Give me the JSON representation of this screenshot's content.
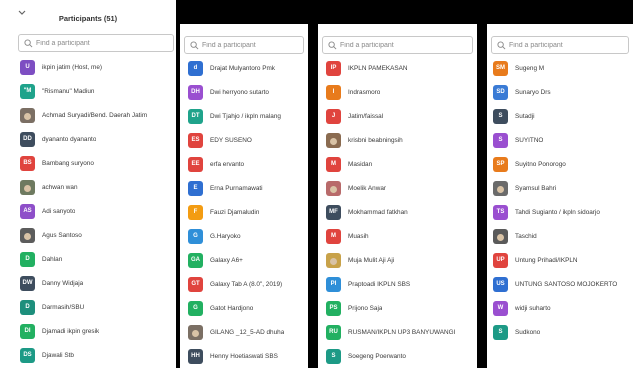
{
  "header": {
    "title": "Participants (51)"
  },
  "search": {
    "placeholder": "Find a participant"
  },
  "colors": {
    "purple": "#8e44ad",
    "teal": "#1e9c8a",
    "slate": "#4a5a6a",
    "red": "#e04040",
    "green": "#27ae60",
    "navy": "#2c3e50",
    "blue": "#2f6fd1",
    "orange": "#f39c12",
    "darkred": "#c0392b",
    "gray": "#4a4a4a",
    "crimson": "#d35400",
    "lightblue": "#3498db"
  },
  "panels": [
    {
      "participants": [
        {
          "initials": "U",
          "color": "#7d4ec2",
          "name": "ikpin jatim (Host, me)"
        },
        {
          "initials": "\"M",
          "color": "#1fa38b",
          "name": "\"Rismanu\" Madiun"
        },
        {
          "initials": "",
          "color": "#7b6f64",
          "photo": true,
          "name": "Achmad Suryadi/Bend. Daerah Jatim"
        },
        {
          "initials": "DD",
          "color": "#3e4d5e",
          "name": "dyananto dyananto"
        },
        {
          "initials": "BS",
          "color": "#e0443e",
          "name": "Bambang suryono"
        },
        {
          "initials": "",
          "color": "#6e7a60",
          "photo": true,
          "name": "achwan wan"
        },
        {
          "initials": "AS",
          "color": "#8e4fc9",
          "name": "Adi sanyoto"
        },
        {
          "initials": "",
          "color": "#5c5c5c",
          "photo": true,
          "name": "Agus Santoso"
        },
        {
          "initials": "D",
          "color": "#22b061",
          "name": "Dahlan"
        },
        {
          "initials": "DW",
          "color": "#3e4d5e",
          "name": "Danny Widjaja"
        },
        {
          "initials": "D",
          "color": "#1d8f7c",
          "name": "Darmasih/SBU"
        },
        {
          "initials": "DI",
          "color": "#22b061",
          "name": "Djamadi ikpin gresik"
        },
        {
          "initials": "DS",
          "color": "#1d9a86",
          "name": "Djawali Stb"
        }
      ]
    },
    {
      "participants": [
        {
          "initials": "d",
          "color": "#2f6fd1",
          "name": "Drajat Mulyantoro Pmk"
        },
        {
          "initials": "DH",
          "color": "#9a4fd0",
          "name": "Dwi herryono sutarto"
        },
        {
          "initials": "DT",
          "color": "#1fa38b",
          "name": "Dwi Tjahjo / ikpln malang"
        },
        {
          "initials": "ES",
          "color": "#e0443e",
          "name": "EDY SUSENO"
        },
        {
          "initials": "EE",
          "color": "#e0443e",
          "name": "erfa ervanto"
        },
        {
          "initials": "E",
          "color": "#2f6fd1",
          "name": "Erna Purnamawati"
        },
        {
          "initials": "F",
          "color": "#f39c12",
          "name": "Fauzi Djamaludin"
        },
        {
          "initials": "G",
          "color": "#2f8fd8",
          "name": "G.Haryoko"
        },
        {
          "initials": "GA",
          "color": "#22b061",
          "name": "Galaxy A6+"
        },
        {
          "initials": "GT",
          "color": "#e0443e",
          "name": "Galaxy Tab A (8.0\", 2019)"
        },
        {
          "initials": "G",
          "color": "#22b061",
          "name": "Gatot Hardjono"
        },
        {
          "initials": "",
          "color": "#7b6f64",
          "photo": true,
          "name": "GILANG _12_5-AD dhuha"
        },
        {
          "initials": "HH",
          "color": "#3e4d5e",
          "name": "Henny Hoetiaswati SBS"
        }
      ]
    },
    {
      "participants": [
        {
          "initials": "IP",
          "color": "#e0443e",
          "name": "IKPLN PAMEKASAN"
        },
        {
          "initials": "I",
          "color": "#e87b1c",
          "name": "Indrasmoro"
        },
        {
          "initials": "J",
          "color": "#e0443e",
          "name": "Jatim/faissal"
        },
        {
          "initials": "",
          "color": "#8a6b50",
          "photo": true,
          "name": "krisbni beabningsih"
        },
        {
          "initials": "M",
          "color": "#e0443e",
          "name": "Masidan"
        },
        {
          "initials": "",
          "color": "#b86a6a",
          "photo": true,
          "name": "Moelik Anwar"
        },
        {
          "initials": "MF",
          "color": "#3e4d5e",
          "name": "Mokhammad fatkhan"
        },
        {
          "initials": "M",
          "color": "#e0443e",
          "name": "Muasih"
        },
        {
          "initials": "",
          "color": "#c8a24a",
          "photo": true,
          "name": "Muja Mulit Aji Aji"
        },
        {
          "initials": "PI",
          "color": "#2f8fd8",
          "name": "Praptoadi IKPLN SBS"
        },
        {
          "initials": "PS",
          "color": "#22b061",
          "name": "Prijono Saja"
        },
        {
          "initials": "RU",
          "color": "#22b061",
          "name": "RUSMAN/IKPLN UP3 BANYUWANGI"
        },
        {
          "initials": "S",
          "color": "#1d9a86",
          "name": "Soegeng Poerwanto"
        }
      ]
    },
    {
      "participants": [
        {
          "initials": "SM",
          "color": "#e87b1c",
          "name": "Sugeng M"
        },
        {
          "initials": "SD",
          "color": "#3a7bd5",
          "name": "Sunaryo Drs"
        },
        {
          "initials": "S",
          "color": "#3e4d5e",
          "name": "Sutadji"
        },
        {
          "initials": "S",
          "color": "#9a4fd0",
          "name": "SUYITNO"
        },
        {
          "initials": "SP",
          "color": "#e87b1c",
          "name": "Suyitno Ponorogo"
        },
        {
          "initials": "",
          "color": "#6b6b6b",
          "photo": true,
          "name": "Syamsul Bahri"
        },
        {
          "initials": "TS",
          "color": "#9a4fd0",
          "name": "Tahdi Sugianto / ikpln sidoarjo"
        },
        {
          "initials": "",
          "color": "#5a5a5a",
          "photo": true,
          "name": "Taschid"
        },
        {
          "initials": "UP",
          "color": "#e0443e",
          "name": "Untung Prihadi/IKPLN"
        },
        {
          "initials": "US",
          "color": "#2f6fd1",
          "name": "UNTUNG SANTOSO MOJOKERTO"
        },
        {
          "initials": "W",
          "color": "#9a4fd0",
          "name": "widji suharto"
        },
        {
          "initials": "S",
          "color": "#1d9a86",
          "name": "Sudkono"
        }
      ]
    }
  ]
}
